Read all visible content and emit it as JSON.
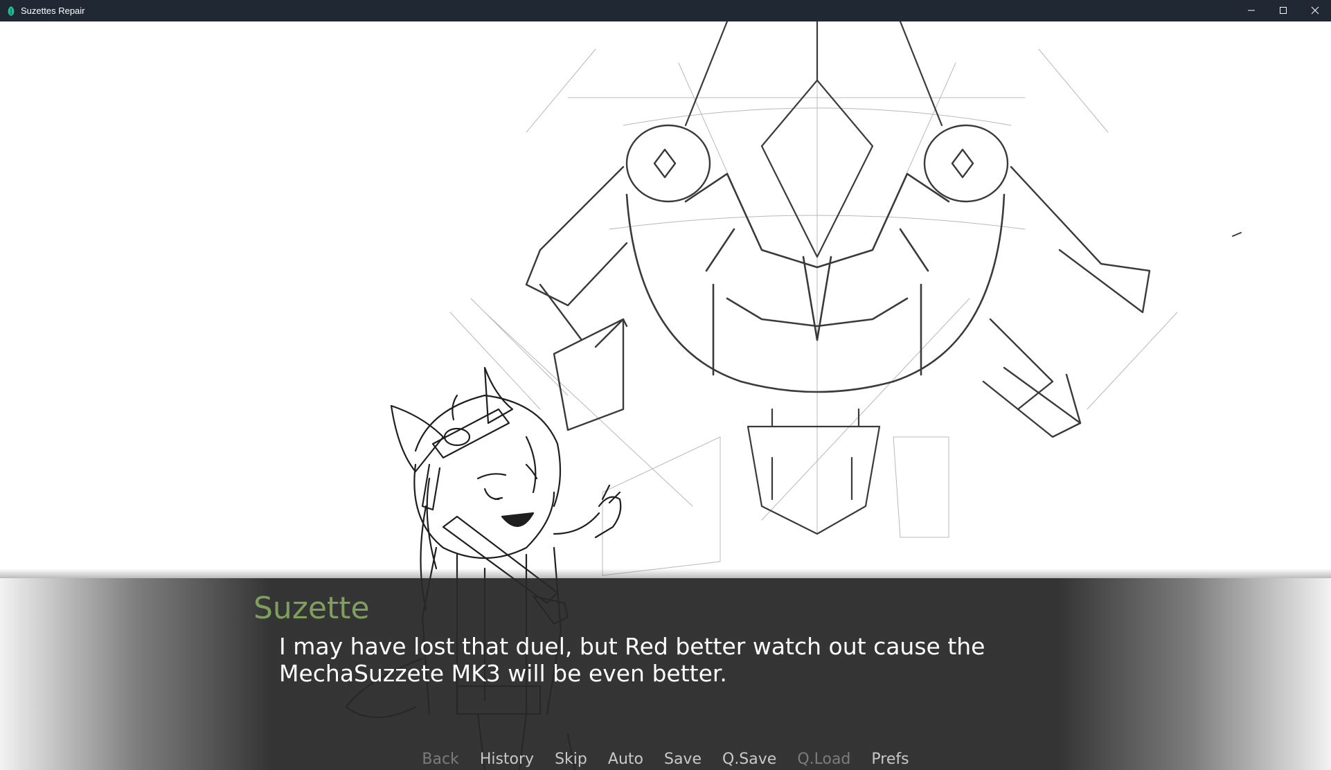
{
  "window": {
    "title": "Suzettes Repair",
    "icon": "game-logo-icon",
    "accent": "#1fbf9a"
  },
  "dialogue": {
    "speaker": "Suzette",
    "speaker_color": "#7fa05d",
    "lines": [
      "I may have lost that duel, but Red better watch out cause the",
      "MechaSuzzete MK3 will be even better."
    ]
  },
  "quick_menu": {
    "back": "Back",
    "history": "History",
    "skip": "Skip",
    "auto": "Auto",
    "save": "Save",
    "qsave": "Q.Save",
    "qload": "Q.Load",
    "prefs": "Prefs"
  },
  "quick_menu_disabled": [
    "back",
    "qload"
  ]
}
